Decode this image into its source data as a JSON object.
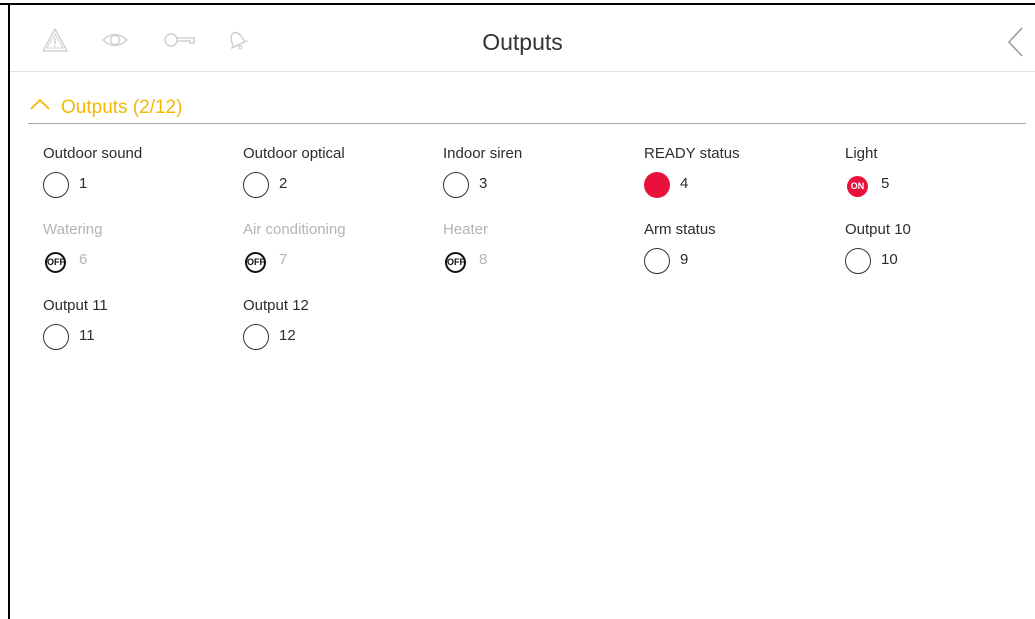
{
  "header": {
    "title": "Outputs",
    "icons": [
      "warning-icon",
      "eye-icon",
      "key-icon",
      "bell-icon"
    ],
    "back_icon": "chevron-left-icon"
  },
  "section": {
    "title": "Outputs (2/12)",
    "chevron_icon": "chevron-up-icon",
    "accent_color": "#f5b800"
  },
  "outputs": [
    {
      "label": "Outdoor sound",
      "number": "1",
      "state": "off",
      "enabled": true
    },
    {
      "label": "Outdoor optical",
      "number": "2",
      "state": "off",
      "enabled": true
    },
    {
      "label": "Indoor siren",
      "number": "3",
      "state": "off",
      "enabled": true
    },
    {
      "label": "READY status",
      "number": "4",
      "state": "active",
      "enabled": true
    },
    {
      "label": "Light",
      "number": "5",
      "state": "on",
      "enabled": true,
      "badge": "ON"
    },
    {
      "label": "Watering",
      "number": "6",
      "state": "off",
      "enabled": false,
      "badge": "OFF"
    },
    {
      "label": "Air conditioning",
      "number": "7",
      "state": "off",
      "enabled": false,
      "badge": "OFF"
    },
    {
      "label": "Heater",
      "number": "8",
      "state": "off",
      "enabled": false,
      "badge": "OFF"
    },
    {
      "label": "Arm status",
      "number": "9",
      "state": "off",
      "enabled": true
    },
    {
      "label": "Output 10",
      "number": "10",
      "state": "off",
      "enabled": true
    },
    {
      "label": "Output 11",
      "number": "11",
      "state": "off",
      "enabled": true
    },
    {
      "label": "Output 12",
      "number": "12",
      "state": "off",
      "enabled": true
    }
  ],
  "colors": {
    "active_red": "#e8113c",
    "disabled_text": "#b4b4b4"
  }
}
